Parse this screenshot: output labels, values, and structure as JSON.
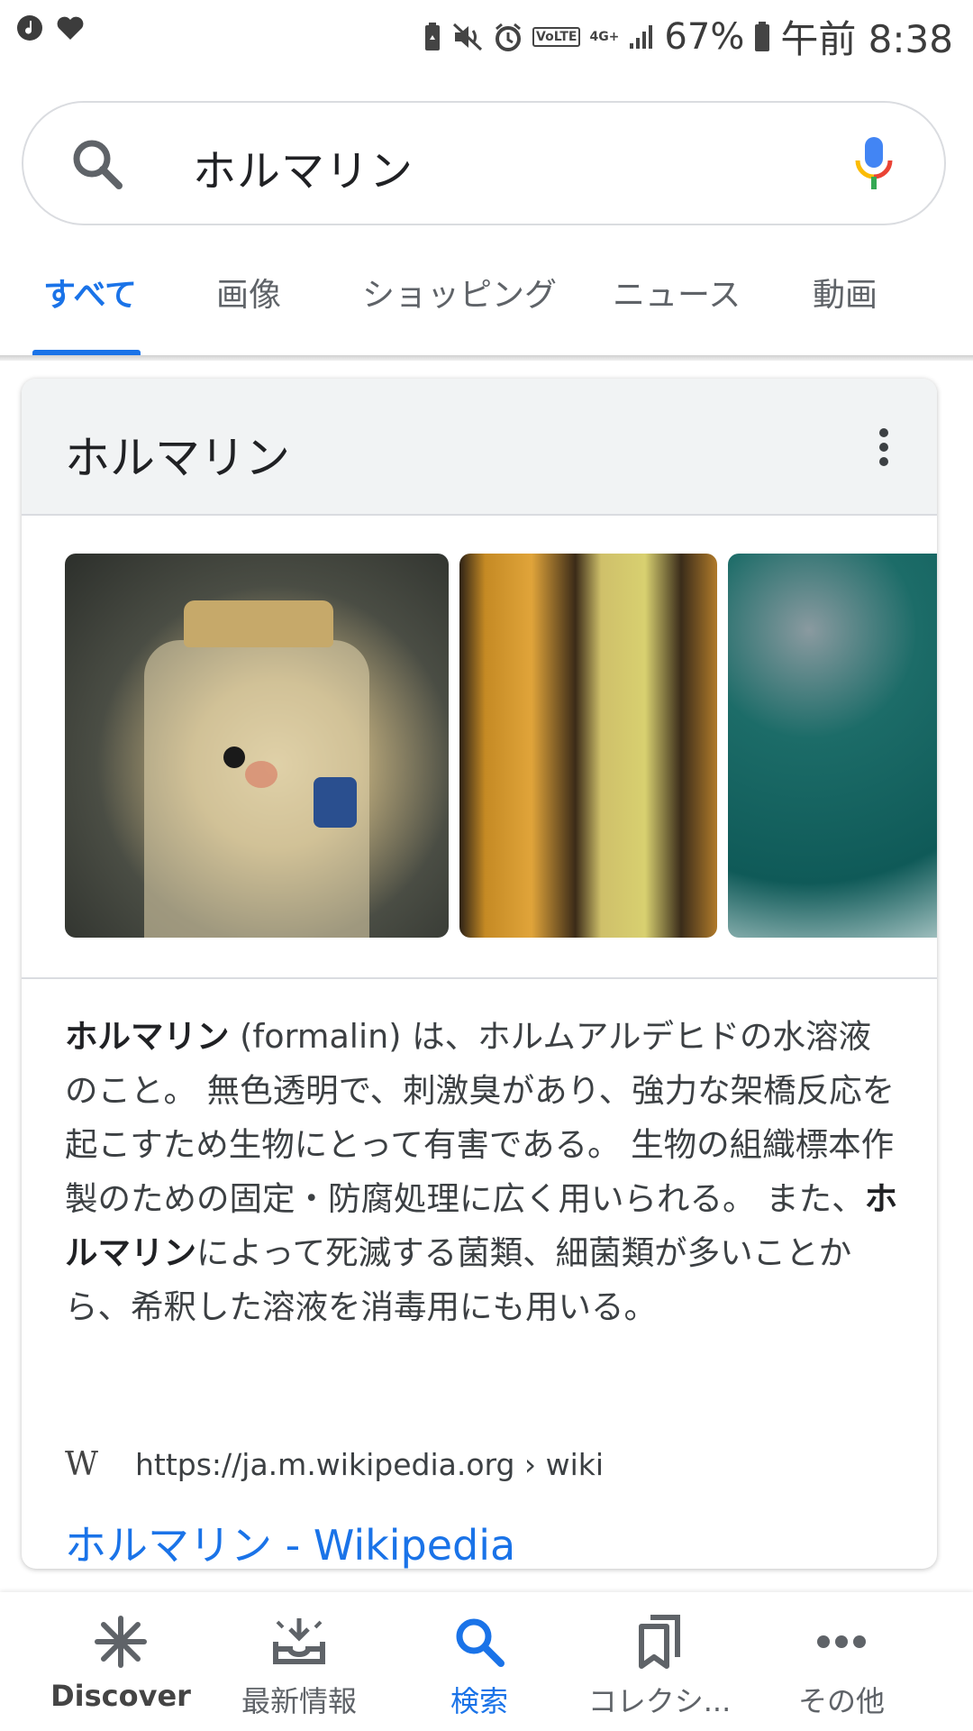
{
  "status_bar": {
    "left_icons": [
      "music-icon",
      "heart-icon"
    ],
    "right_icons": [
      "battery-saver-icon",
      "mute-icon",
      "alarm-icon",
      "volte-icon",
      "network-4g-icon",
      "signal-icon"
    ],
    "volte_label": "VoLTE",
    "network_label": "4G+",
    "battery_percent": "67%",
    "time": "午前 8:38"
  },
  "search": {
    "query": "ホルマリン",
    "colors": {
      "mic_blue": "#4285f4",
      "mic_red": "#ea4335",
      "mic_yellow": "#fbbc05",
      "mic_green": "#34a853"
    }
  },
  "tabs": [
    {
      "label": "すべて",
      "active": true
    },
    {
      "label": "画像",
      "active": false
    },
    {
      "label": "ショッピング",
      "active": false
    },
    {
      "label": "ニュース",
      "active": false
    },
    {
      "label": "動画",
      "active": false
    }
  ],
  "knowledge_card": {
    "title": "ホルマリン",
    "images": [
      "preserved-plush-jar",
      "specimen-jars",
      "medical-scene"
    ],
    "description": {
      "term": "ホルマリン",
      "part1": " (formalin) は、ホルムアルデヒドの水溶液のこと。 無色透明で、刺激臭があり、強力な架橋反応を起こすため生物にとって有害である。 生物の組織標本作製のための固定・防腐処理に広く用いられる。 また、",
      "term2": "ホルマリン",
      "part2": "によって死滅する菌類、細菌類が多いことから、希釈した溶液を消毒用にも用いる。"
    },
    "source": {
      "logo": "W",
      "url": "https://ja.m.wikipedia.org › wiki"
    },
    "link_text": "ホルマリン - Wikipedia"
  },
  "bottom_nav": [
    {
      "label": "Discover",
      "icon": "asterisk-icon"
    },
    {
      "label": "最新情報",
      "icon": "updates-tray-icon"
    },
    {
      "label": "検索",
      "icon": "search-icon",
      "active": true
    },
    {
      "label": "コレクシ...",
      "icon": "collections-icon"
    },
    {
      "label": "その他",
      "icon": "more-horizontal-icon"
    }
  ],
  "accent_color": "#1a73e8"
}
